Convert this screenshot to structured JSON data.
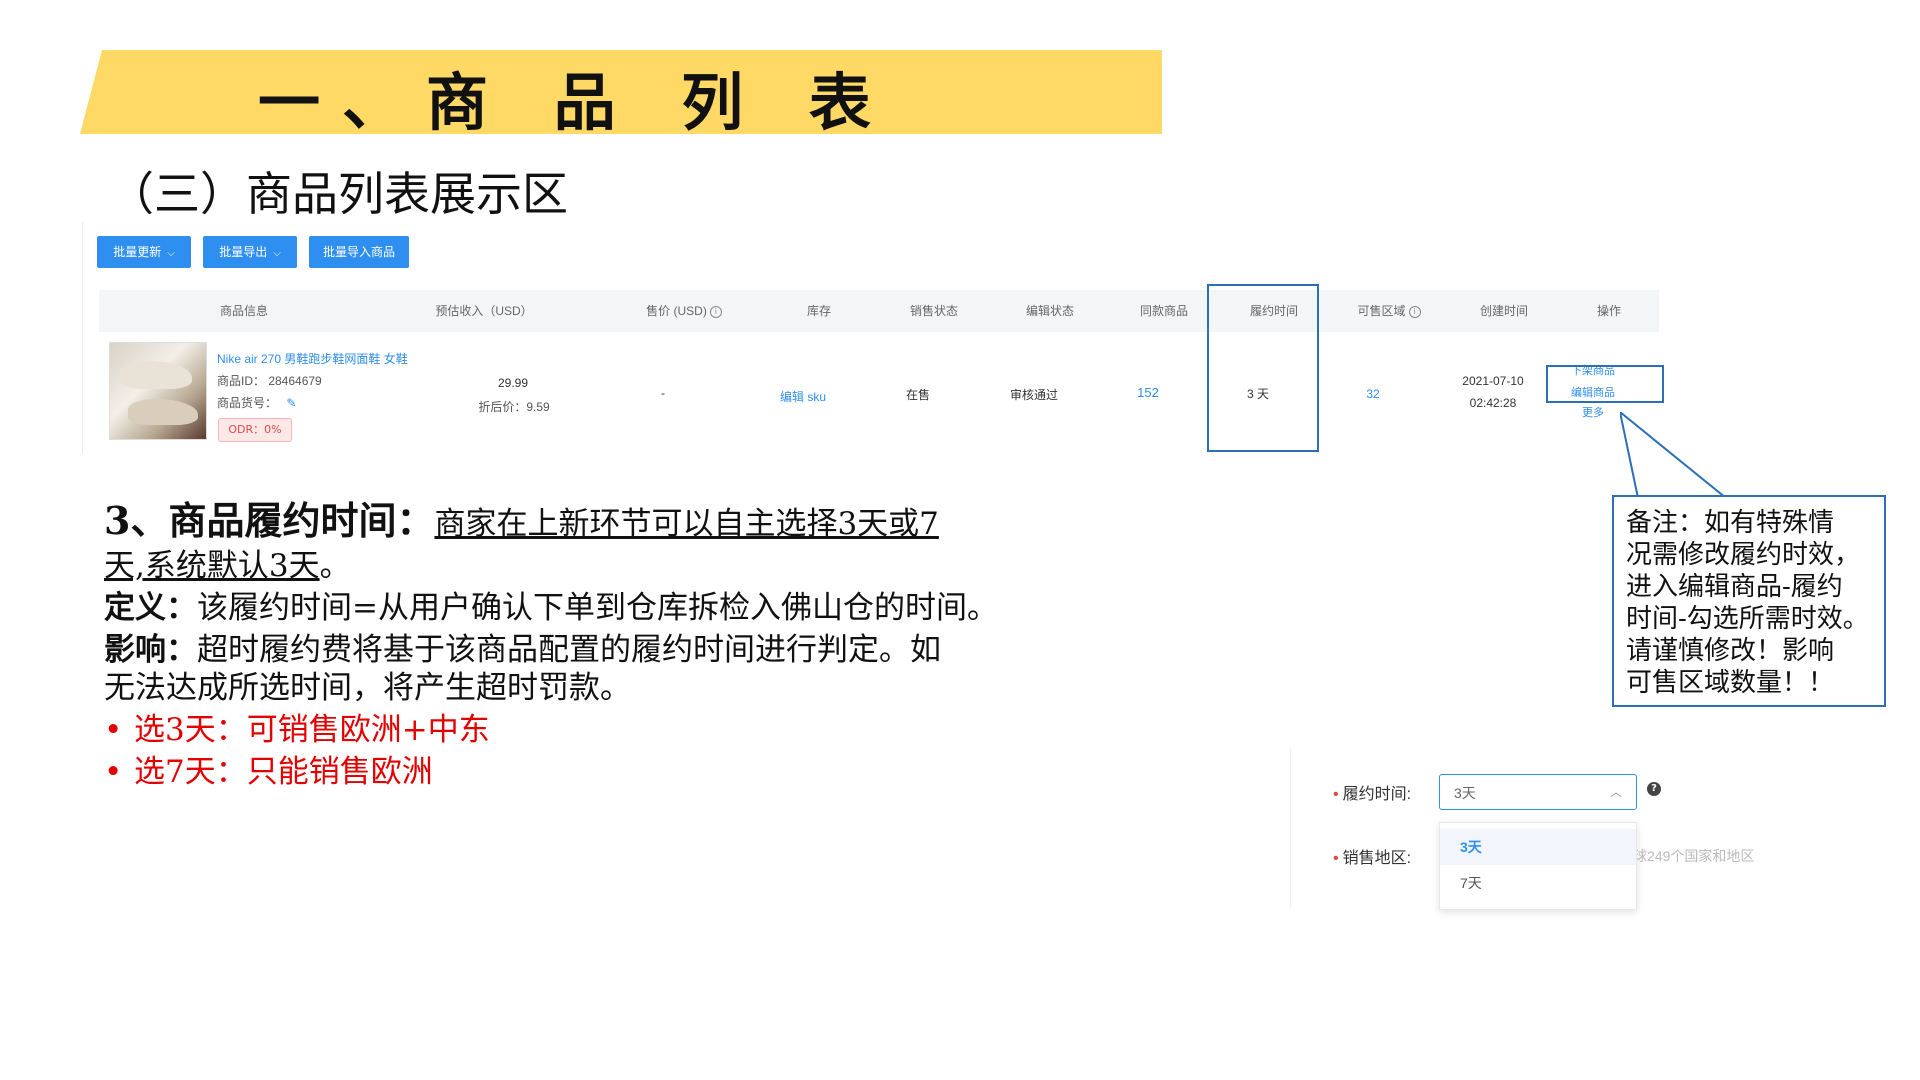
{
  "header": {
    "title": "一、商 品 列 表",
    "subtitle": "（三）商品列表展示区"
  },
  "toolbar": {
    "batch_update": "批量更新",
    "batch_export": "批量导出",
    "batch_import": "批量导入商品"
  },
  "table": {
    "headers": [
      "商品信息",
      "预估收入（USD）",
      "售价 (USD)",
      "库存",
      "销售状态",
      "编辑状态",
      "同款商品",
      "履约时间",
      "可售区域",
      "创建时间",
      "操作"
    ],
    "row": {
      "product_name": "Nike air 270 男鞋跑步鞋网面鞋 女鞋",
      "product_id": "商品ID： 28464679",
      "product_sku_label": "商品货号：",
      "odr": "ODR：0%",
      "income": "29.99",
      "discount_price": "折后价：9.59",
      "price": "-",
      "stock": "编辑 sku",
      "sale_status": "在售",
      "edit_status": "审核通过",
      "same_items": "152",
      "fulfillment_time": "3 天",
      "sale_regions": "32",
      "created_date": "2021-07-10",
      "created_time": "02:42:28",
      "actions": [
        "下架商品",
        "编辑商品",
        "更多"
      ]
    }
  },
  "content": {
    "heading": "3、商品履约时间：",
    "heading_underlined": "商家在上新环节可以自主选择3天或7",
    "heading_underlined_2": "天,系统默认3天",
    "heading_end": "。",
    "def_label": "定义：",
    "def_text": "该履约时间=从用户确认下单到仓库拆检入佛山仓的时间。",
    "impact_label": "影响：",
    "impact_text": "超时履约费将基于该商品配置的履约时间进行判定。如",
    "impact_text_2": "无法达成所选时间，将产生超时罚款。",
    "bullets": [
      "选3天：可销售欧洲+中东",
      "选7天：只能销售欧洲"
    ]
  },
  "note": {
    "lines": [
      "备注：如有特殊情",
      "况需修改履约时效，",
      "进入编辑商品-履约",
      "时间-勾选所需时效。",
      "请谨慎修改！影响",
      "可售区域数量！！"
    ]
  },
  "form": {
    "fulfillment_label": "履约时间:",
    "fulfillment_value": "3天",
    "sale_region_label": "销售地区:",
    "options": [
      "3天",
      "7天"
    ],
    "dim_text": "球249个国家和地区"
  },
  "colors": {
    "banner": "#ffd966",
    "primary_blue": "#2f8ff0",
    "highlight_border": "#2b6fb6",
    "red": "#e30000"
  }
}
